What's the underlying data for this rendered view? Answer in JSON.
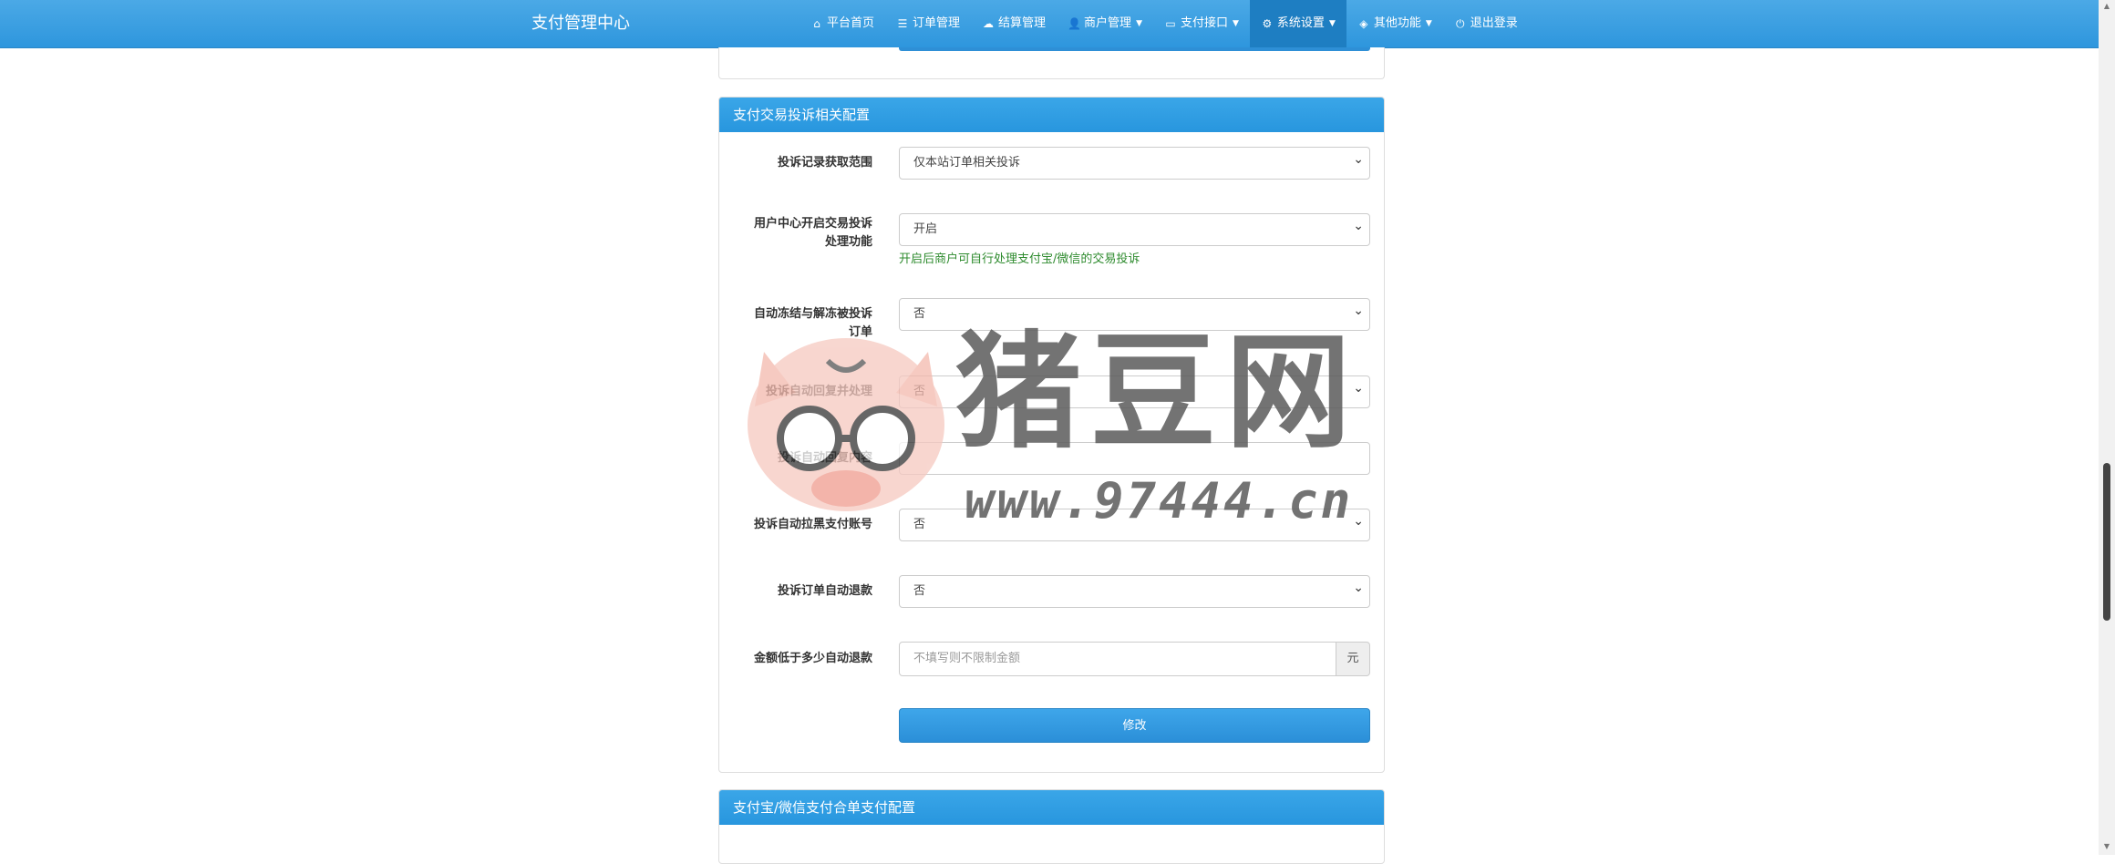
{
  "brand": "支付管理中心",
  "nav": [
    {
      "icon": "home-icon",
      "glyph": "⌂",
      "label": "平台首页",
      "caret": false,
      "active": false
    },
    {
      "icon": "list-icon",
      "glyph": "☰",
      "label": "订单管理",
      "caret": false,
      "active": false
    },
    {
      "icon": "cloud-icon",
      "glyph": "☁",
      "label": "结算管理",
      "caret": false,
      "active": false
    },
    {
      "icon": "user-icon",
      "glyph": "👤",
      "label": "商户管理",
      "caret": true,
      "active": false
    },
    {
      "icon": "credit-card-icon",
      "glyph": "▭",
      "label": "支付接口",
      "caret": true,
      "active": false
    },
    {
      "icon": "gear-icon",
      "glyph": "⚙",
      "label": "系统设置",
      "caret": true,
      "active": true
    },
    {
      "icon": "cube-icon",
      "glyph": "◈",
      "label": "其他功能",
      "caret": true,
      "active": false
    },
    {
      "icon": "power-icon",
      "glyph": "⏻",
      "label": "退出登录",
      "caret": false,
      "active": false
    }
  ],
  "panel1": {
    "heading": "支付交易投诉相关配置",
    "fields": {
      "scope": {
        "label": "投诉记录获取范围",
        "value": "仅本站订单相关投诉"
      },
      "user_center": {
        "label_line1": "用户中心开启交易投诉",
        "label_line2": "处理功能",
        "value": "开启",
        "help": "开启后商户可自行处理支付宝/微信的交易投诉"
      },
      "auto_freeze": {
        "label_line1": "自动冻结与解冻被投诉",
        "label_line2": "订单",
        "value": "否"
      },
      "auto_reply": {
        "label": "投诉自动回复并处理",
        "value": "否"
      },
      "reply_content": {
        "label": "投诉自动回复内容",
        "value": ""
      },
      "auto_blacklist": {
        "label": "投诉自动拉黑支付账号",
        "value": "否"
      },
      "auto_refund": {
        "label": "投诉订单自动退款",
        "value": "否"
      },
      "refund_limit": {
        "label": "金额低于多少自动退款",
        "placeholder": "不填写则不限制金额",
        "addon": "元"
      }
    },
    "submit": "修改"
  },
  "panel2": {
    "heading": "支付宝/微信支付合单支付配置"
  },
  "watermark": {
    "title": "猪豆网",
    "url": "www.97444.cn"
  }
}
